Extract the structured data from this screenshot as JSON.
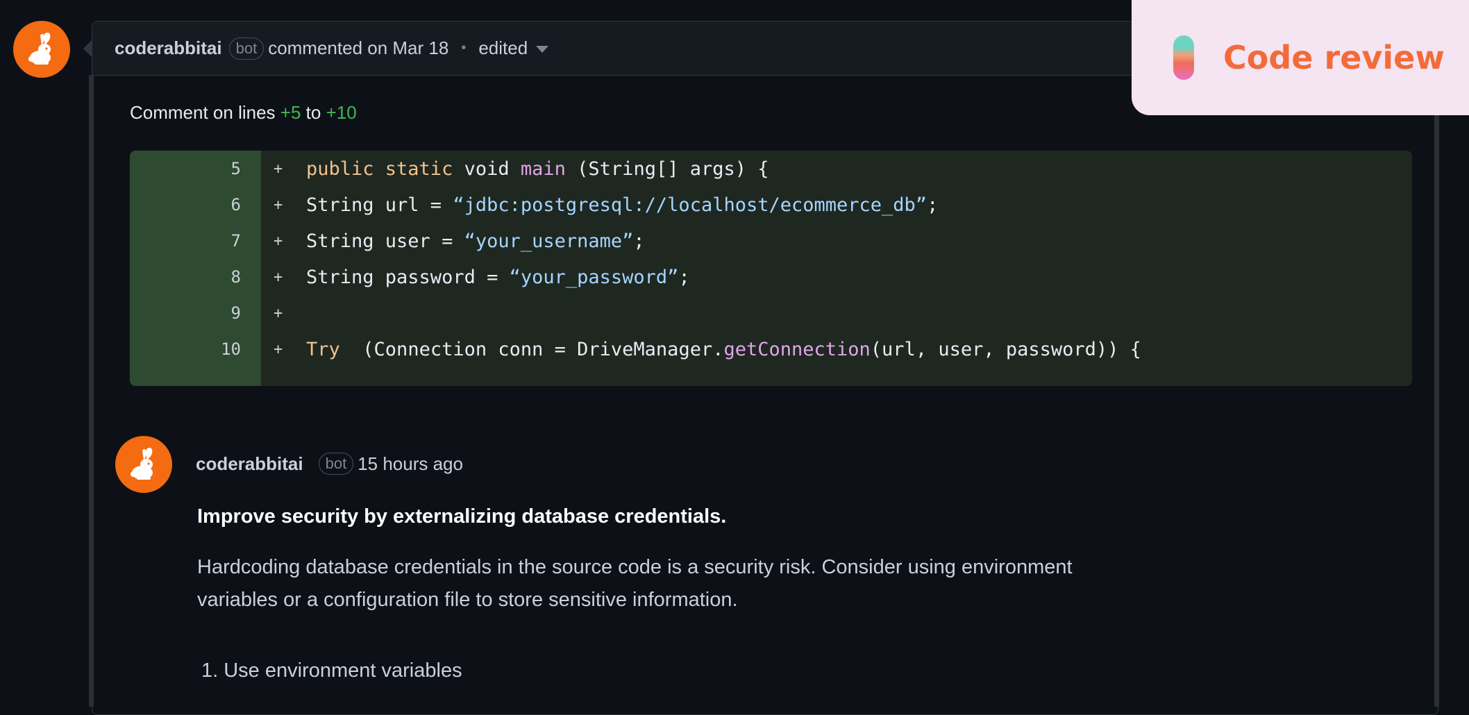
{
  "thread": {
    "author": "coderabbitai",
    "badge": "bot",
    "commented": "commented on Mar 18",
    "separator": "•",
    "edited": "edited"
  },
  "comment_lines": {
    "prefix": "Comment on lines",
    "start": "+5",
    "connector": "to",
    "end": "+10"
  },
  "code": {
    "rows": [
      {
        "line": "5",
        "marker": "+"
      },
      {
        "line": "6",
        "marker": "+"
      },
      {
        "line": "7",
        "marker": "+"
      },
      {
        "line": "8",
        "marker": "+"
      },
      {
        "line": "9",
        "marker": "+"
      },
      {
        "line": "10",
        "marker": "+"
      }
    ],
    "tokens": {
      "r5_kw": "public static",
      "r5_a": " void ",
      "r5_fn": "main",
      "r5_b": " (String[] args) {",
      "r6_a": "String url = ",
      "r6_str": "“jdbc:postgresql://localhost/ecommerce_db”",
      "r6_b": ";",
      "r7_a": "String user = ",
      "r7_str": "“your_username”",
      "r7_b": ";",
      "r8_a": "String password = ",
      "r8_str": "“your_password”",
      "r8_b": ";",
      "r10_kw": "Try",
      "r10_a": "  (Connection conn = DriveManager.",
      "r10_fn": "getConnection",
      "r10_b": "(url, user, password)) {"
    }
  },
  "reply": {
    "author": "coderabbitai",
    "badge": "bot",
    "time": "15 hours ago",
    "title": "Improve security by externalizing database credentials.",
    "body": "Hardcoding database credentials in the source code is a security risk. Consider using environment variables or a configuration file to store sensitive information.",
    "list_item": "1. Use environment variables"
  },
  "overlay": {
    "label": "Code review"
  },
  "colors": {
    "brand_orange": "#f46b12",
    "diff_added": "#3fb950",
    "overlay_bg": "#f5e4f1",
    "overlay_text": "#f26b3a"
  },
  "icons": {
    "avatar": "rabbit-icon",
    "dropdown": "chevron-down-icon"
  }
}
